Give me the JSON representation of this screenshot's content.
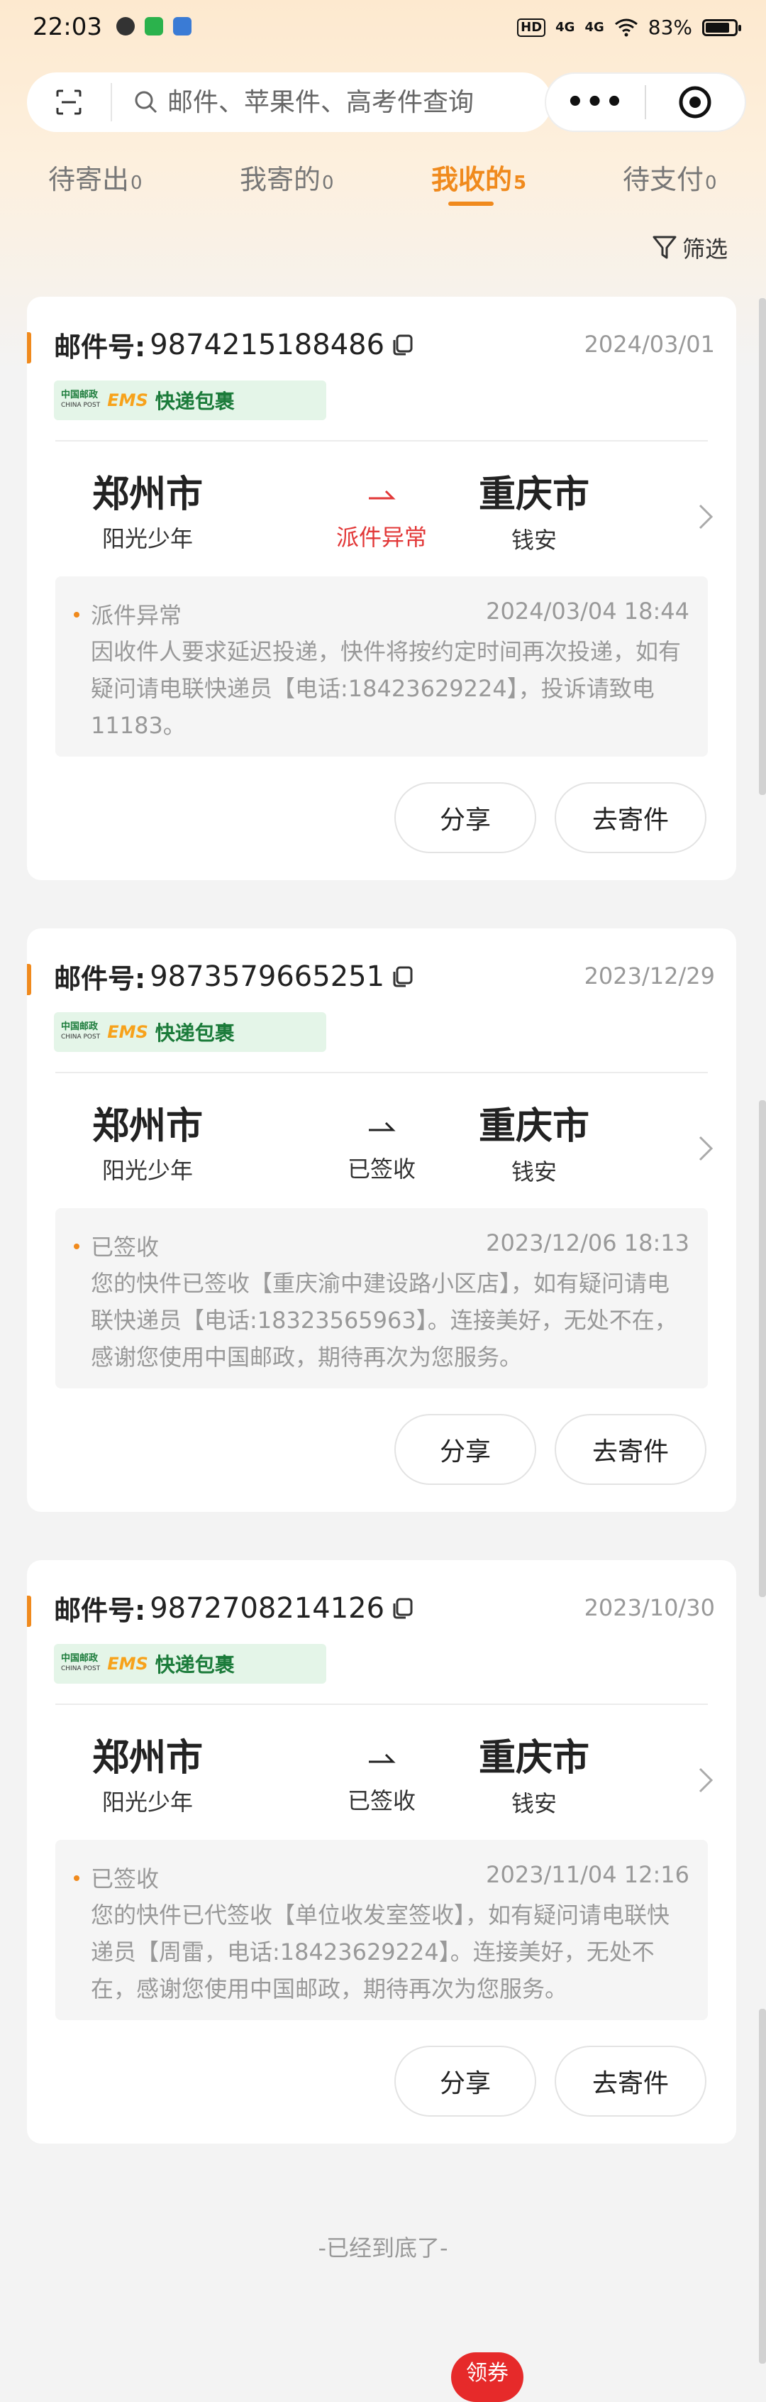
{
  "status_bar": {
    "time": "22:03",
    "battery": "83%",
    "hd_tag": "HD",
    "signal_1": "4G",
    "signal_2": "4G",
    "battery_level": 0.83
  },
  "search": {
    "placeholder": "邮件、苹果件、高考件查询"
  },
  "capsule": {
    "more": "•••"
  },
  "tabs": [
    {
      "label": "待寄出",
      "count": "0",
      "active": false
    },
    {
      "label": "我寄的",
      "count": "0",
      "active": false
    },
    {
      "label": "我收的",
      "count": "5",
      "active": true
    },
    {
      "label": "待支付",
      "count": "0",
      "active": false
    }
  ],
  "filter_label": "筛选",
  "accent_color": "#f08a1d",
  "error_color": "#e23838",
  "cards": [
    {
      "mail_label": "邮件号:",
      "mail_no": "9874215188486",
      "date": "2024/03/01",
      "badge": {
        "cp_cn": "中国邮政",
        "cp_en": "CHINA POST",
        "ems": "EMS",
        "label": "快递包裹"
      },
      "from_city": "郑州市",
      "from_name": "阳光少年",
      "to_city": "重庆市",
      "to_name": "钱安",
      "status": "派件异常",
      "status_error": true,
      "track_title": "派件异常",
      "track_time": "2024/03/04 18:44",
      "track_desc": "因收件人要求延迟投递，快件将按约定时间再次投递，如有疑问请电联快递员【电话:18423629224】，投诉请致电11183。",
      "share_label": "分享",
      "send_label": "去寄件"
    },
    {
      "mail_label": "邮件号:",
      "mail_no": "9873579665251",
      "date": "2023/12/29",
      "badge": {
        "cp_cn": "中国邮政",
        "cp_en": "CHINA POST",
        "ems": "EMS",
        "label": "快递包裹"
      },
      "from_city": "郑州市",
      "from_name": "阳光少年",
      "to_city": "重庆市",
      "to_name": "钱安",
      "status": "已签收",
      "status_error": false,
      "track_title": "已签收",
      "track_time": "2023/12/06 18:13",
      "track_desc": "您的快件已签收【重庆渝中建设路小区店】，如有疑问请电联快递员【电话:18323565963】。连接美好，无处不在，感谢您使用中国邮政，期待再次为您服务。",
      "share_label": "分享",
      "send_label": "去寄件"
    },
    {
      "mail_label": "邮件号:",
      "mail_no": "9872708214126",
      "date": "2023/10/30",
      "badge": {
        "cp_cn": "中国邮政",
        "cp_en": "CHINA POST",
        "ems": "EMS",
        "label": "快递包裹"
      },
      "from_city": "郑州市",
      "from_name": "阳光少年",
      "to_city": "重庆市",
      "to_name": "钱安",
      "status": "已签收",
      "status_error": false,
      "track_title": "已签收",
      "track_time": "2023/11/04 12:16",
      "track_desc": "您的快件已代签收【单位收发室签收】，如有疑问请电联快递员【周雷，电话:18423629224】。连接美好，无处不在，感谢您使用中国邮政，期待再次为您服务。",
      "share_label": "分享",
      "send_label": "去寄件"
    }
  ],
  "end_text": "-已经到底了-",
  "coupon_label": "领券"
}
